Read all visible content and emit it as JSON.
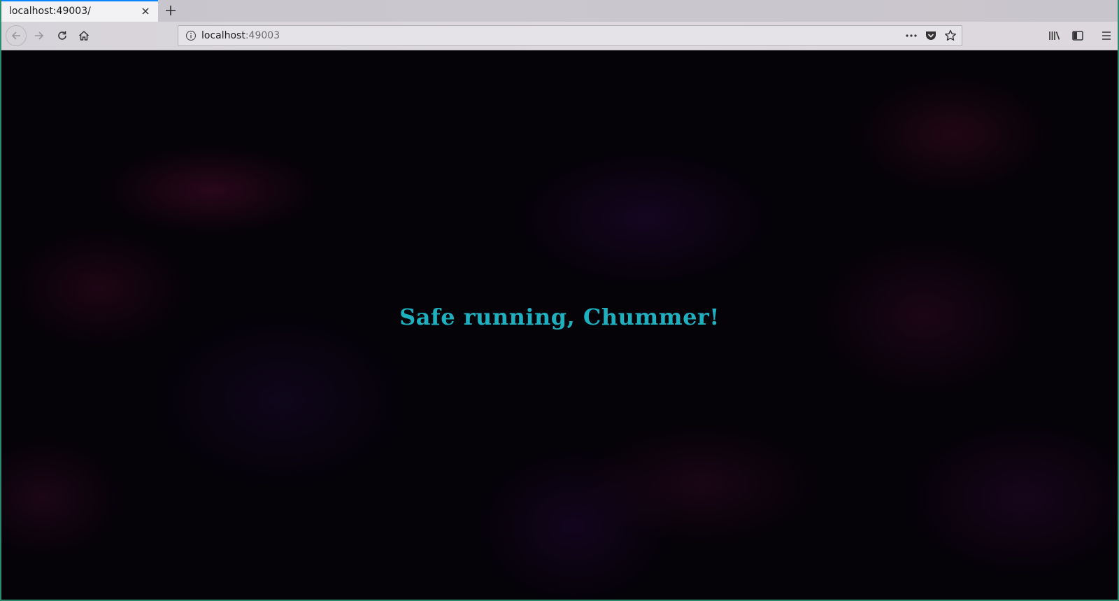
{
  "browser": {
    "tab": {
      "title": "localhost:49003/"
    },
    "url": {
      "host": "localhost",
      "port": ":49003"
    },
    "icons": {
      "tab_close": "close-icon",
      "new_tab": "plus-icon",
      "back": "arrow-left-icon",
      "forward": "arrow-right-icon",
      "reload": "reload-icon",
      "home": "home-icon",
      "site_info": "info-icon",
      "page_actions": "ellipsis-icon",
      "pocket": "pocket-icon",
      "bookmark": "star-icon",
      "library": "library-icon",
      "sidebar": "sidebar-icon",
      "menu": "hamburger-menu-icon"
    }
  },
  "page": {
    "headline": "Safe running, Chummer!",
    "headline_color": "#1fb0c0",
    "background_color": "#050208"
  }
}
